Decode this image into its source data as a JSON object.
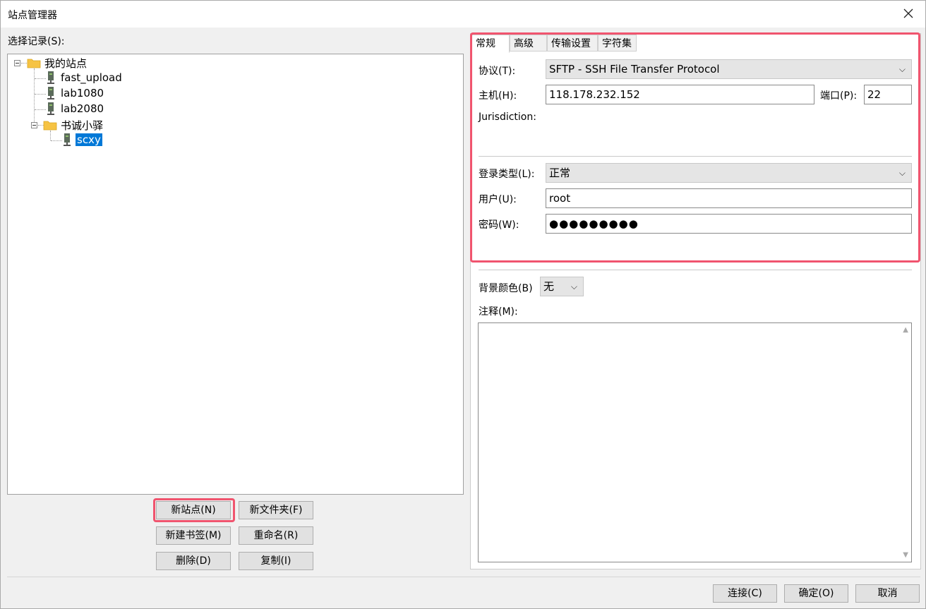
{
  "window": {
    "title": "站点管理器"
  },
  "left": {
    "select_label": "选择记录(S):",
    "tree": {
      "root": "我的站点",
      "sites": [
        "fast_upload",
        "lab1080",
        "lab2080"
      ],
      "subfolder": "书诚小驿",
      "subsite": "scxy"
    },
    "buttons": {
      "new_site": "新站点(N)",
      "new_folder": "新文件夹(F)",
      "new_bookmark": "新建书签(M)",
      "rename": "重命名(R)",
      "delete": "删除(D)",
      "copy": "复制(I)"
    }
  },
  "tabs": [
    "常规",
    "高级",
    "传输设置",
    "字符集"
  ],
  "general": {
    "protocol_label": "协议(T):",
    "protocol_value": "SFTP - SSH File Transfer Protocol",
    "host_label": "主机(H):",
    "host_value": "118.178.232.152",
    "port_label": "端口(P):",
    "port_value": "22",
    "jurisdiction_label": "Jurisdiction:",
    "logon_type_label": "登录类型(L):",
    "logon_type_value": "正常",
    "user_label": "用户(U):",
    "user_value": "root",
    "password_label": "密码(W):",
    "password_value": "●●●●●●●●●",
    "bgcolor_label": "背景颜色(B)",
    "bgcolor_value": "无",
    "notes_label": "注释(M):"
  },
  "footer": {
    "connect": "连接(C)",
    "ok": "确定(O)",
    "cancel": "取消"
  },
  "colors": {
    "highlight": "#f0546e",
    "selection": "#0078d7"
  }
}
